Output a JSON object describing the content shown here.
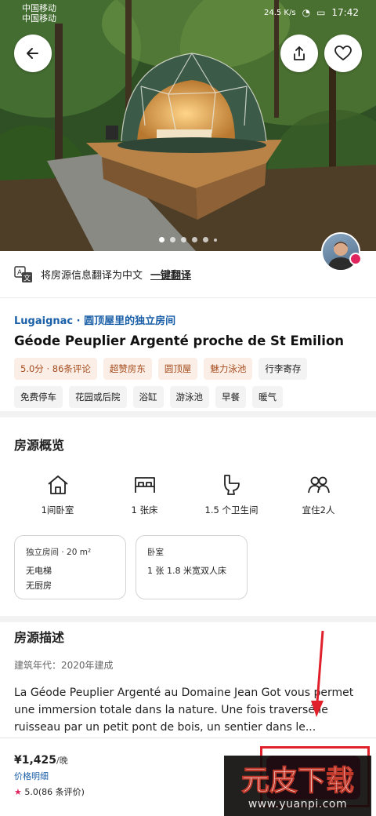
{
  "status_bar": {
    "carrier_1": "中国移动",
    "carrier_2": "中国移动",
    "speed": "24.5 K/s",
    "time": "17:42"
  },
  "hero": {
    "icons": {
      "back": "arrow-left-icon",
      "share": "share-icon",
      "favorite": "heart-icon"
    },
    "photo_count_dots": 6,
    "active_photo": 0
  },
  "translate_bar": {
    "text": "将房源信息翻译为中文",
    "action": "一键翻译"
  },
  "listing": {
    "subtitle": "Lugaignac · 圆顶屋里的独立房间",
    "title": "Géode Peuplier Argenté proche de St Emilion",
    "tags": [
      {
        "label": "5.0分 · 86条评论",
        "highlight": true
      },
      {
        "label": "超赞房东",
        "highlight": true
      },
      {
        "label": "圆顶屋",
        "highlight": true
      },
      {
        "label": "魅力泳池",
        "highlight": true
      },
      {
        "label": "行李寄存",
        "highlight": false
      },
      {
        "label": "免费停车",
        "highlight": false
      },
      {
        "label": "花园或后院",
        "highlight": false
      },
      {
        "label": "浴缸",
        "highlight": false
      },
      {
        "label": "游泳池",
        "highlight": false
      },
      {
        "label": "早餐",
        "highlight": false
      },
      {
        "label": "暖气",
        "highlight": false
      }
    ]
  },
  "overview": {
    "title": "房源概览",
    "features": [
      {
        "icon": "house-icon",
        "label": "1间卧室"
      },
      {
        "icon": "bed-icon",
        "label": "1 张床"
      },
      {
        "icon": "toilet-icon",
        "label": "1.5 个卫生间"
      },
      {
        "icon": "guests-icon",
        "label": "宜住2人"
      }
    ],
    "cards": [
      {
        "heading": "独立房间 · 20 m²",
        "lines": [
          "无电梯",
          "无厨房"
        ]
      },
      {
        "heading": "卧室",
        "lines": [
          "1 张 1.8 米宽双人床"
        ]
      }
    ]
  },
  "description": {
    "title": "房源描述",
    "year": "建筑年代：2020年建成",
    "body": "La Géode Peuplier Argenté au Domaine Jean Got vous permet une immersion totale dans la nature. Une fois traversé le ruisseau par un petit pont de bois, un sentier dans le..."
  },
  "booking_bar": {
    "price": "¥1,425",
    "price_unit": "/晚",
    "details_link": "价格明细",
    "rating_star": "★",
    "rating": "5.0",
    "reviews": "(86 条评价)"
  },
  "watermark": {
    "logo_text": "元皮下载",
    "url": "www.yuanpi.com"
  },
  "colors": {
    "brand": "#d7145a",
    "link": "#1a5fa8",
    "tag_highlight_bg": "#fbeee6",
    "tag_highlight_text": "#a54d1f",
    "annotation_red": "#e0202a"
  }
}
